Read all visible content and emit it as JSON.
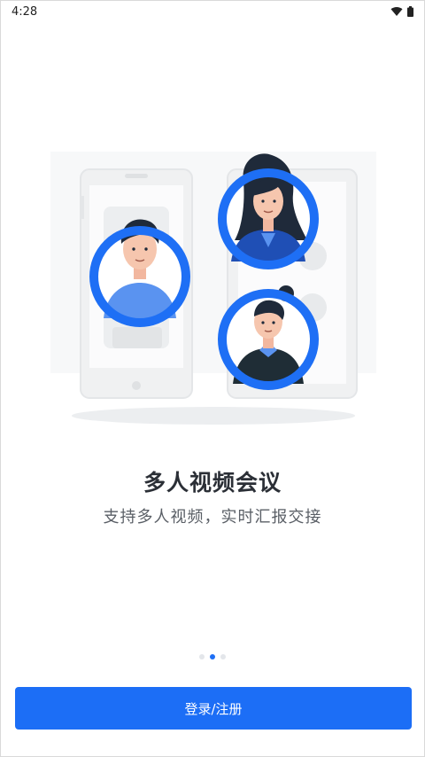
{
  "status_bar": {
    "time": "4:28",
    "icons": [
      "wifi-icon",
      "battery-icon"
    ]
  },
  "onboarding": {
    "title": "多人视频会议",
    "subtitle": "支持多人视频，实时汇报交接",
    "pager": {
      "total": 3,
      "active_index": 1
    }
  },
  "actions": {
    "login_label": "登录/注册"
  },
  "colors": {
    "accent": "#1c6ef6",
    "ring": "#1e6ff5",
    "title": "#2b2f36",
    "subtitle": "#5a5f66"
  }
}
